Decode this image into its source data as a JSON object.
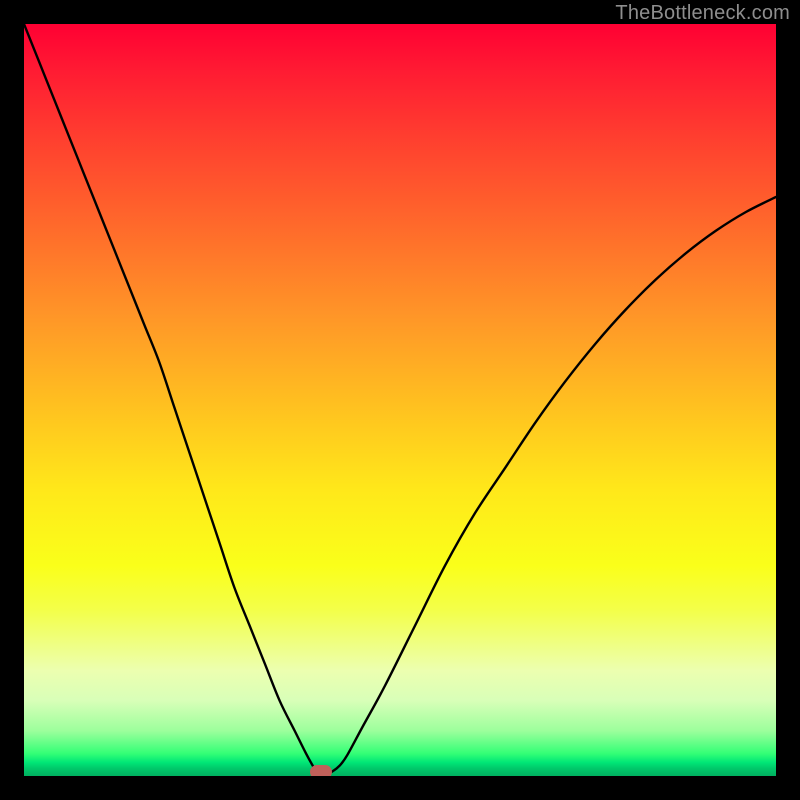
{
  "watermark": "TheBottleneck.com",
  "colors": {
    "frame": "#000000",
    "curve": "#000000",
    "marker": "#c0605a"
  },
  "chart_data": {
    "type": "line",
    "title": "",
    "xlabel": "",
    "ylabel": "",
    "xlim": [
      0,
      100
    ],
    "ylim": [
      0,
      100
    ],
    "grid": false,
    "legend": false,
    "series": [
      {
        "name": "bottleneck-curve",
        "x": [
          0,
          2,
          4,
          6,
          8,
          10,
          12,
          14,
          16,
          18,
          20,
          22,
          24,
          26,
          28,
          30,
          32,
          34,
          36,
          37.5,
          38.5,
          39,
          40,
          41,
          42,
          43,
          45,
          48,
          52,
          56,
          60,
          64,
          68,
          72,
          76,
          80,
          84,
          88,
          92,
          96,
          100
        ],
        "y": [
          100,
          95,
          90,
          85,
          80,
          75,
          70,
          65,
          60,
          55,
          49,
          43,
          37,
          31,
          25,
          20,
          15,
          10,
          6,
          3,
          1.2,
          0.5,
          0.2,
          0.6,
          1.4,
          2.8,
          6.5,
          12,
          20,
          28,
          35,
          41,
          47,
          52.5,
          57.5,
          62,
          66,
          69.5,
          72.5,
          75,
          77
        ]
      }
    ],
    "annotations": [
      {
        "name": "optimal-point-marker",
        "x": 39.5,
        "y": 0.5
      }
    ],
    "gradient_stops": [
      {
        "pos": 0,
        "color": "#ff0033"
      },
      {
        "pos": 0.5,
        "color": "#ffd21f"
      },
      {
        "pos": 0.75,
        "color": "#f3ff4a"
      },
      {
        "pos": 0.97,
        "color": "#34ff76"
      },
      {
        "pos": 1.0,
        "color": "#00b060"
      }
    ]
  }
}
